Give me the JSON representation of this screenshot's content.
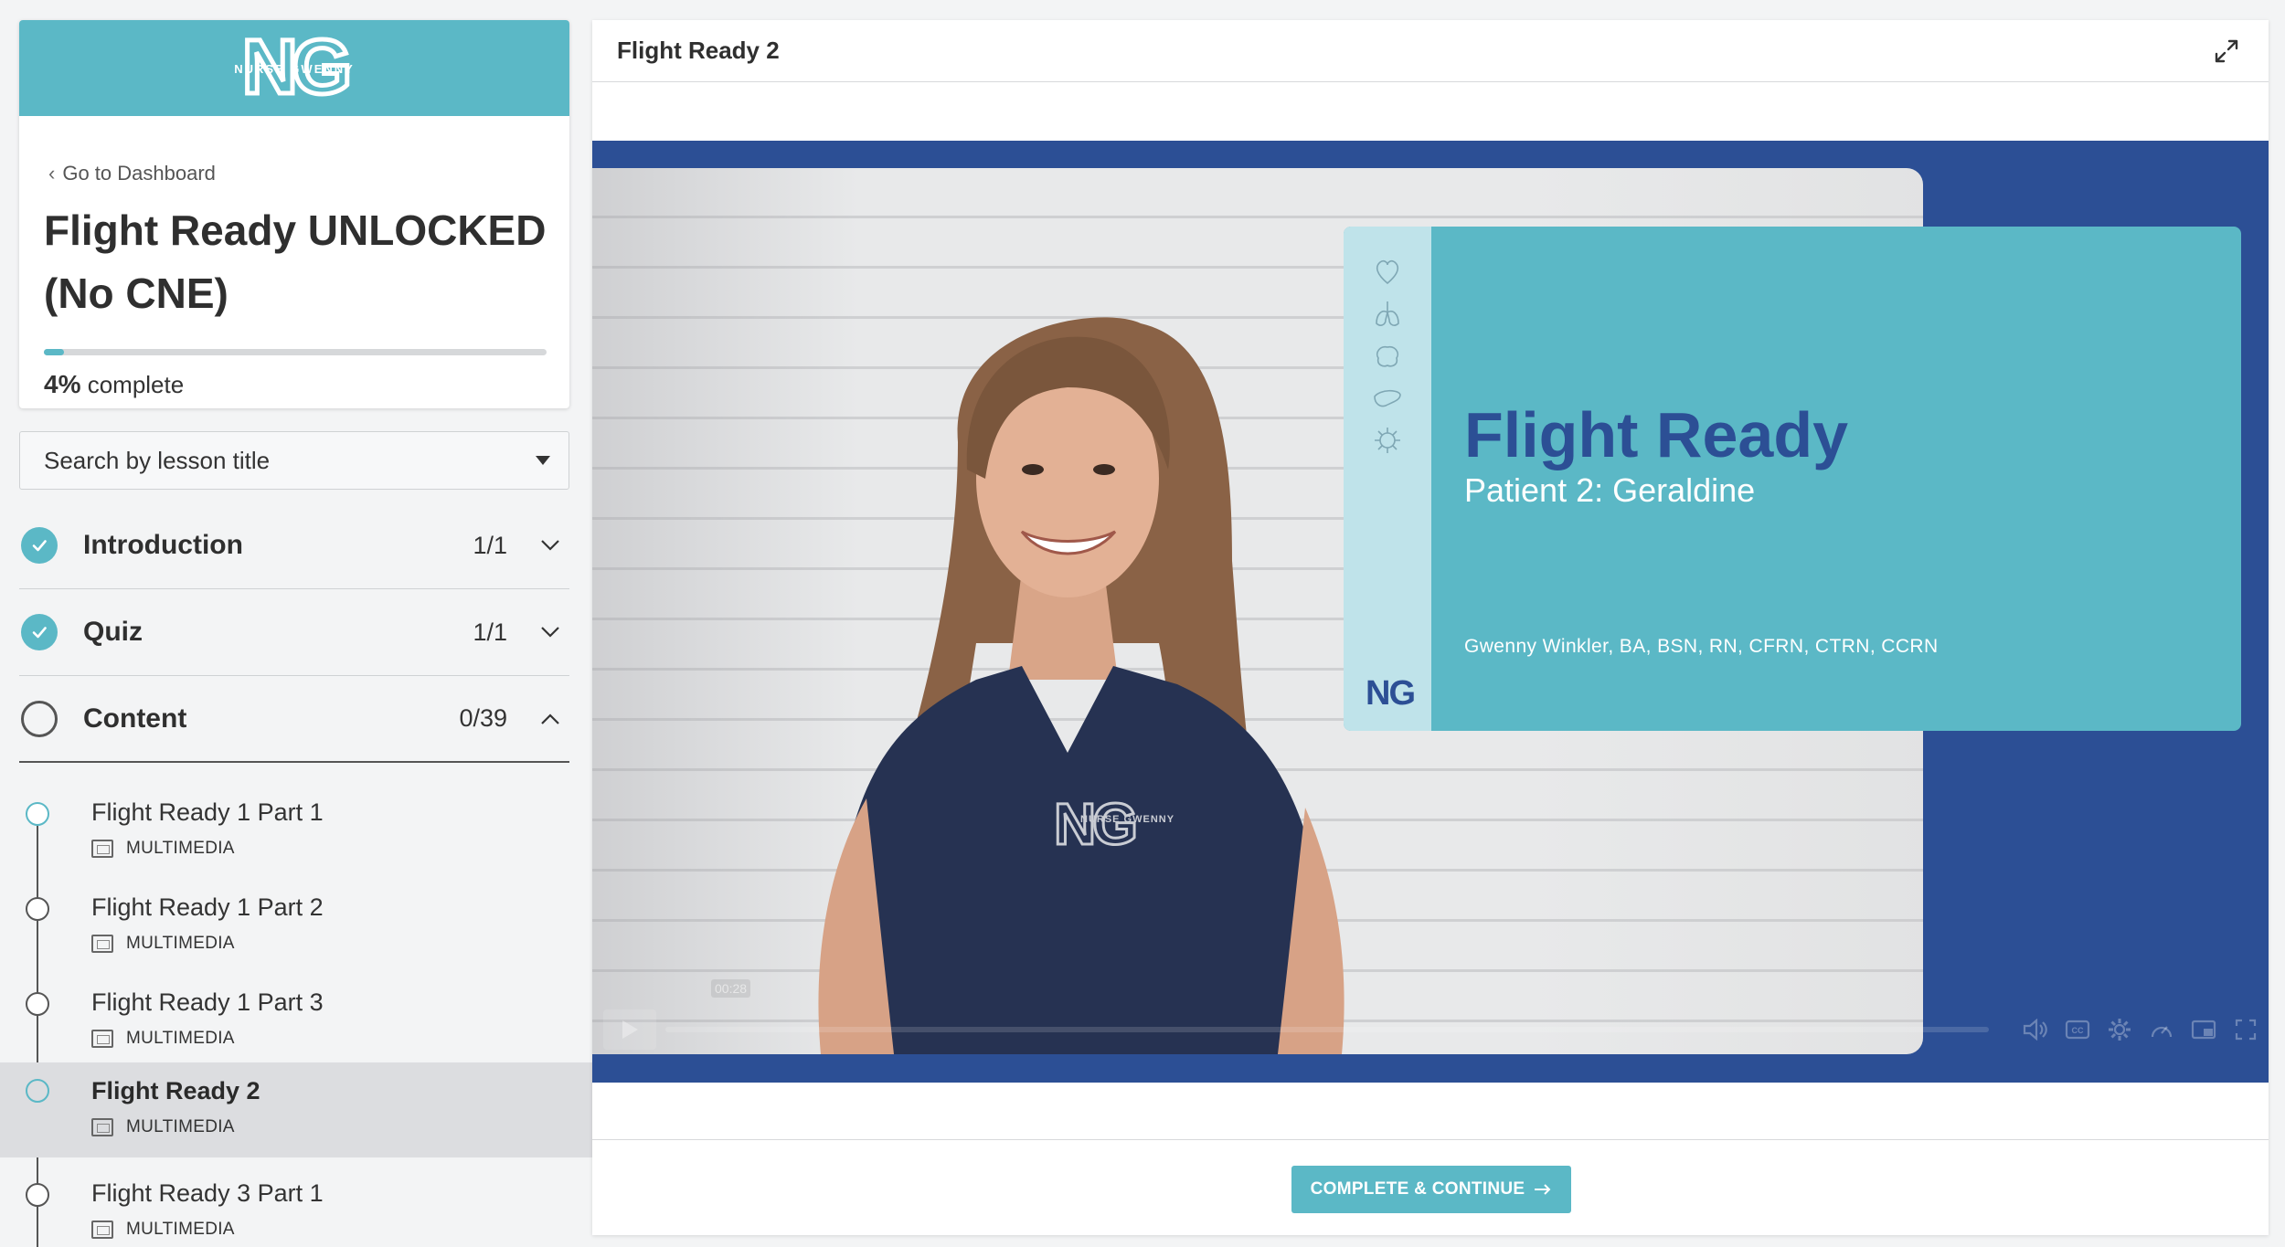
{
  "brand": {
    "logo_letters": "NG",
    "logo_caption": "NURSE GWENNY",
    "accent_color": "#5bb8c6",
    "navy_color": "#2c4f95"
  },
  "sidebar": {
    "back_link": "Go to Dashboard",
    "course_title": "Flight Ready UNLOCKED (No CNE)",
    "progress_percent": "4%",
    "progress_value": 0.04,
    "progress_suffix": "complete",
    "search_placeholder": "Search by lesson title",
    "sections": [
      {
        "title": "Introduction",
        "count": "1/1",
        "status": "complete",
        "expanded": false
      },
      {
        "title": "Quiz",
        "count": "1/1",
        "status": "complete",
        "expanded": false
      },
      {
        "title": "Content",
        "count": "0/39",
        "status": "incomplete",
        "expanded": true
      }
    ],
    "lessons": [
      {
        "title": "Flight Ready 1 Part 1",
        "type": "MULTIMEDIA"
      },
      {
        "title": "Flight Ready 1 Part 2",
        "type": "MULTIMEDIA"
      },
      {
        "title": "Flight Ready 1 Part 3",
        "type": "MULTIMEDIA"
      },
      {
        "title": "Flight Ready 2",
        "type": "MULTIMEDIA"
      },
      {
        "title": "Flight Ready 3 Part 1",
        "type": "MULTIMEDIA"
      }
    ]
  },
  "main": {
    "lesson_title": "Flight Ready 2",
    "video": {
      "slide_title": "Flight Ready",
      "slide_subtitle": "Patient 2: Geraldine",
      "slide_author": "Gwenny Winkler, BA, BSN, RN, CFRN, CTRN, CCRN",
      "slide_logo": "NG",
      "shirt_logo": "NG",
      "shirt_caption": "NURSE GWENNY",
      "time_tooltip": "00:28"
    },
    "cta_label": "COMPLETE & CONTINUE"
  }
}
